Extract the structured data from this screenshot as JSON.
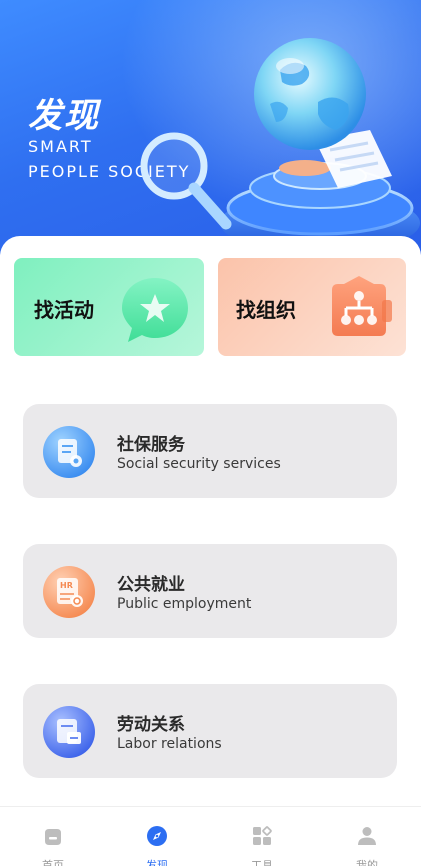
{
  "banner": {
    "title": "发现",
    "subtitle_line1": "SMART",
    "subtitle_line2": "PEOPLE SOCIETY"
  },
  "quick_actions": [
    {
      "label": "找活动",
      "icon": "star-chat-icon",
      "color": "#7ff0bf"
    },
    {
      "label": "找组织",
      "icon": "org-chart-icon",
      "color": "#fbc3aa"
    }
  ],
  "services": [
    {
      "title": "社保服务",
      "subtitle": "Social security services",
      "icon": "social-security-icon",
      "color": "#4a9cf2"
    },
    {
      "title": "公共就业",
      "subtitle": "Public employment",
      "icon": "hr-resume-icon",
      "color": "#f59a66"
    },
    {
      "title": "劳动关系",
      "subtitle": "Labor relations",
      "icon": "labor-contract-icon",
      "color": "#4b74ee"
    }
  ],
  "bottom_nav": {
    "items": [
      {
        "label": "首页",
        "icon": "home-icon"
      },
      {
        "label": "发现",
        "icon": "compass-icon",
        "active": true
      },
      {
        "label": "工具",
        "icon": "apps-icon"
      },
      {
        "label": "我的",
        "icon": "person-icon"
      }
    ]
  },
  "colors": {
    "accent": "#2c6ef2",
    "banner": "#3f8cff",
    "card_bg": "#eae9eb"
  }
}
